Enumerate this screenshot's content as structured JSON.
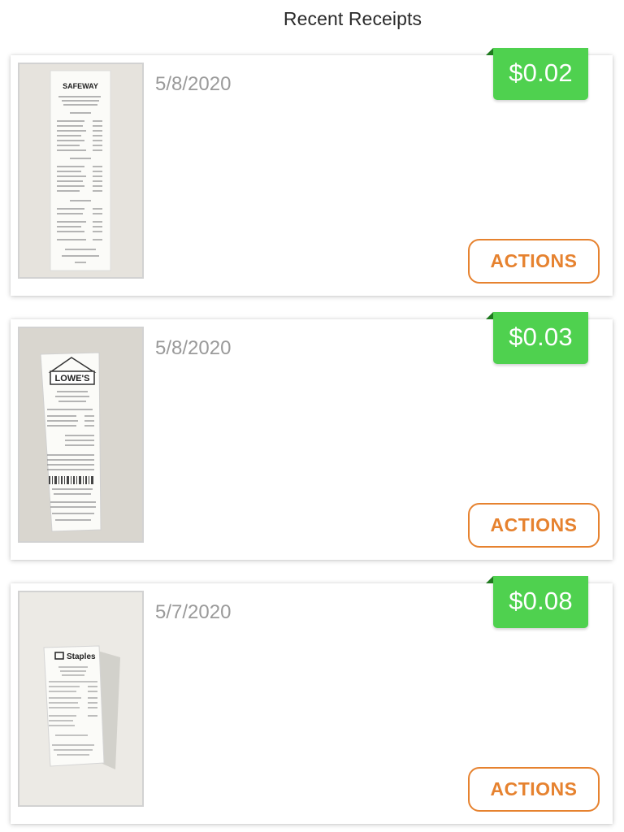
{
  "header": {
    "title": "Recent Receipts"
  },
  "receipts": [
    {
      "date": "5/8/2020",
      "amount": "$0.02",
      "actions_label": "ACTIONS",
      "store": "SAFEWAY"
    },
    {
      "date": "5/8/2020",
      "amount": "$0.03",
      "actions_label": "ACTIONS",
      "store": "LOWE'S"
    },
    {
      "date": "5/7/2020",
      "amount": "$0.08",
      "actions_label": "ACTIONS",
      "store": "Staples"
    }
  ],
  "colors": {
    "price_tag": "#4fd14f",
    "price_tag_fold": "#1f7a1f",
    "actions_accent": "#e6822f",
    "date_text": "#9a9a9a"
  }
}
